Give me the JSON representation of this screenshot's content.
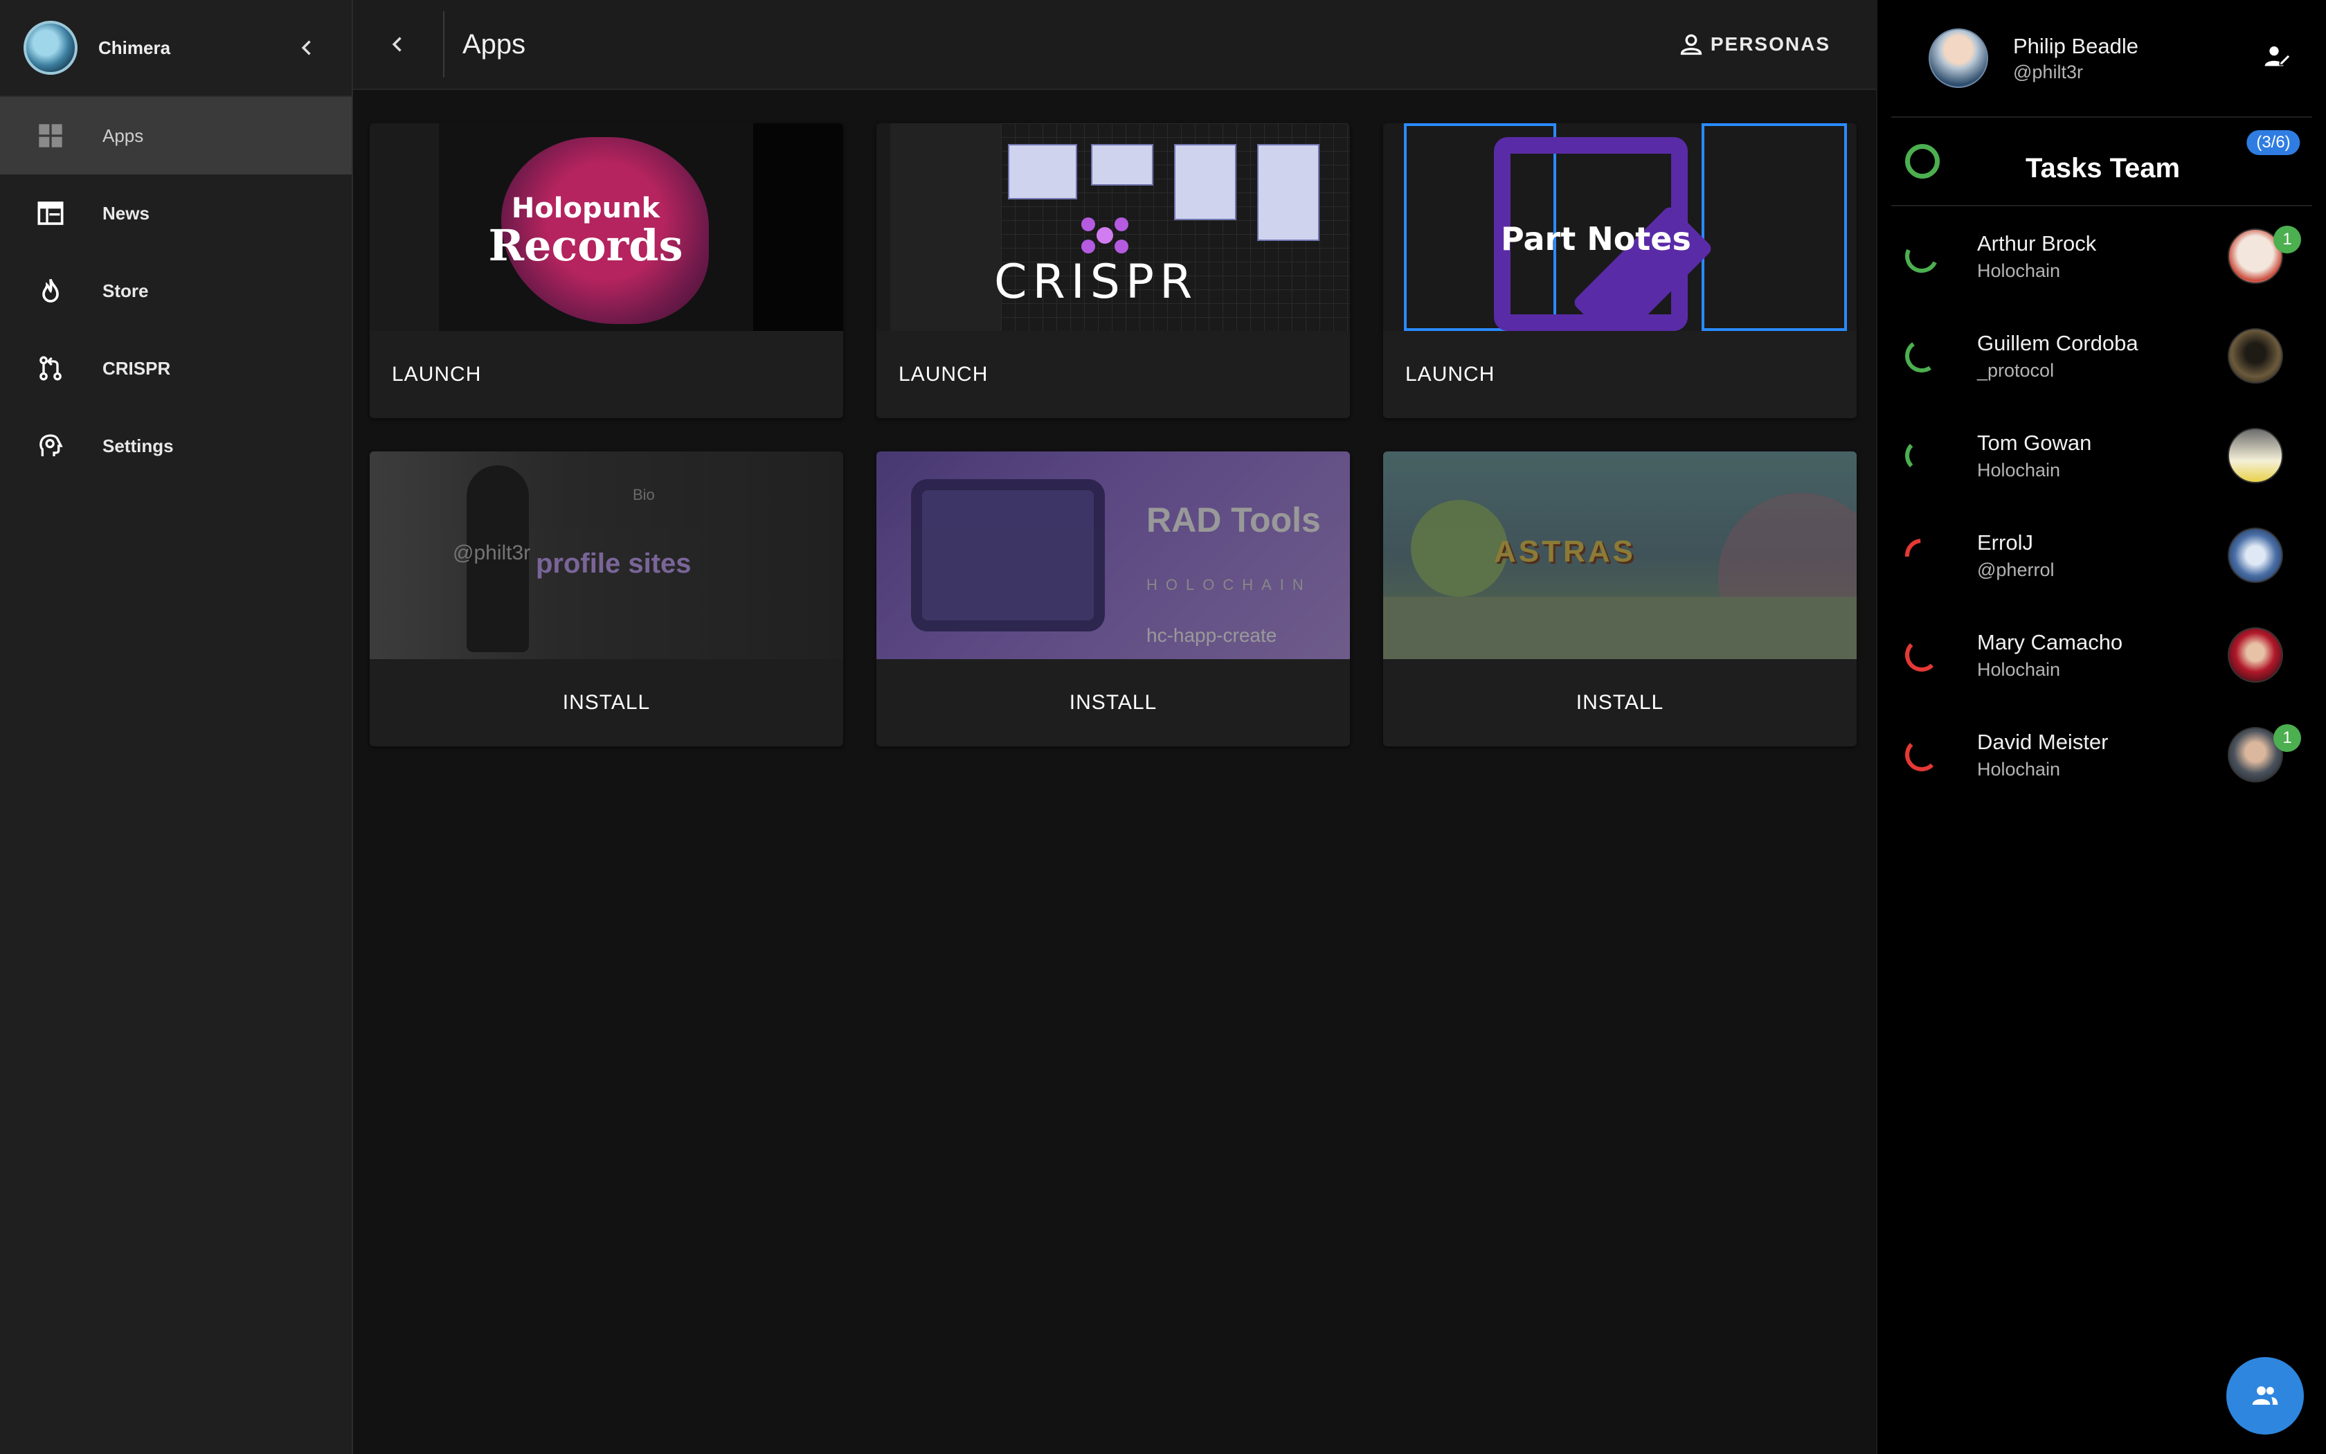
{
  "app": {
    "name": "Chimera"
  },
  "sidebar": {
    "items": [
      {
        "label": "Apps",
        "icon": "apps-grid-icon",
        "active": true
      },
      {
        "label": "News",
        "icon": "news-icon",
        "active": false
      },
      {
        "label": "Store",
        "icon": "fire-icon",
        "active": false
      },
      {
        "label": "CRISPR",
        "icon": "pull-request-icon",
        "active": false
      },
      {
        "label": "Settings",
        "icon": "settings-head-icon",
        "active": false
      }
    ]
  },
  "header": {
    "title": "Apps",
    "personas_label": "PERSONAS"
  },
  "apps": [
    {
      "thumb_title_1": "Holopunk",
      "thumb_title_2": "Records",
      "action": "LAUNCH"
    },
    {
      "thumb_title": "CRISPR",
      "action": "LAUNCH"
    },
    {
      "thumb_title": "Part Notes",
      "action": "LAUNCH"
    },
    {
      "thumb_handle": "@philt3r",
      "thumb_title": "profile sites",
      "thumb_bio": "Bio",
      "action": "INSTALL"
    },
    {
      "thumb_title": "RAD Tools",
      "thumb_subtitle": "HOLOCHAIN",
      "thumb_caption": "hc-happ-create",
      "action": "INSTALL"
    },
    {
      "thumb_title": "ASTRAS",
      "action": "INSTALL"
    }
  ],
  "profile": {
    "name": "Philip Beadle",
    "handle": "@philt3r"
  },
  "team": {
    "name": "Tasks Team",
    "count": "(3/6)"
  },
  "members": [
    {
      "name": "Arthur Brock",
      "subtitle": "Holochain",
      "status_color": "#4caf50",
      "badge": "1"
    },
    {
      "name": "Guillem Cordoba",
      "subtitle": "_protocol",
      "status_color": "#4caf50",
      "badge": ""
    },
    {
      "name": "Tom Gowan",
      "subtitle": "Holochain",
      "status_color": "#4caf50",
      "badge": ""
    },
    {
      "name": "ErrolJ",
      "subtitle": "@pherrol",
      "status_color": "#e53935",
      "badge": ""
    },
    {
      "name": "Mary Camacho",
      "subtitle": "Holochain",
      "status_color": "#e53935",
      "badge": ""
    },
    {
      "name": "David Meister",
      "subtitle": "Holochain",
      "status_color": "#e53935",
      "badge": "1"
    }
  ],
  "colors": {
    "accent": "#2e86de",
    "online": "#4caf50",
    "offline": "#e53935"
  }
}
